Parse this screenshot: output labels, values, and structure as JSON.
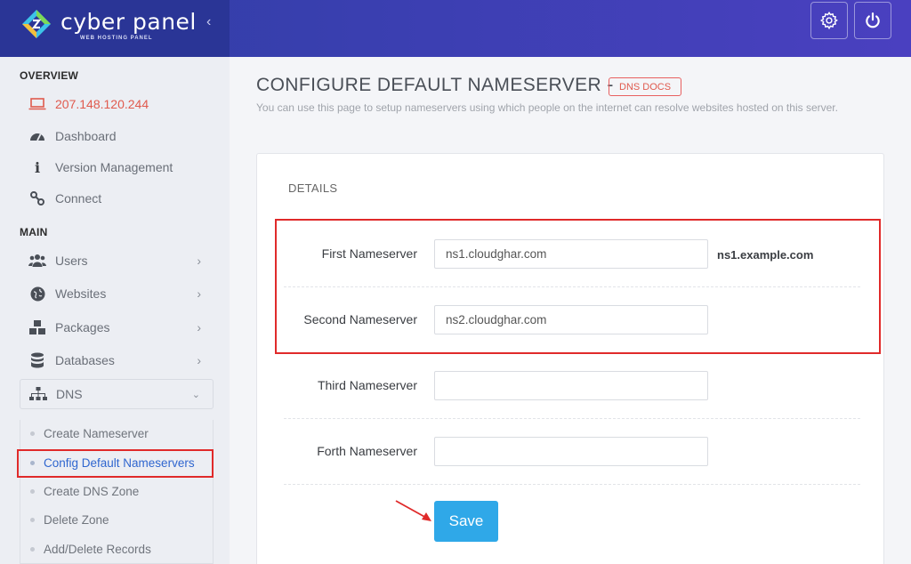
{
  "brand": {
    "name": "cyber panel",
    "tagline": "WEB HOSTING PANEL"
  },
  "topbar": {
    "settings_icon": "gear-icon",
    "power_icon": "power-icon"
  },
  "sidebar": {
    "overview_heading": "OVERVIEW",
    "ip": "207.148.120.244",
    "dashboard": "Dashboard",
    "version": "Version Management",
    "connect": "Connect",
    "main_heading": "MAIN",
    "users": "Users",
    "websites": "Websites",
    "packages": "Packages",
    "databases": "Databases",
    "dns": "DNS",
    "dns_items": [
      "Create Nameserver",
      "Config Default Nameservers",
      "Create DNS Zone",
      "Delete Zone",
      "Add/Delete Records"
    ]
  },
  "page": {
    "title": "CONFIGURE DEFAULT NAMESERVER -",
    "docs_badge": "DNS DOCS",
    "subtitle": "You can use this page to setup nameservers using which people on the internet can resolve websites hosted on this server.",
    "details": "DETAILS"
  },
  "form": {
    "first_label": "First Nameserver",
    "first_value": "ns1.cloudghar.com",
    "first_hint": "ns1.example.com",
    "second_label": "Second Nameserver",
    "second_value": "ns2.cloudghar.com",
    "third_label": "Third Nameserver",
    "third_value": "",
    "forth_label": "Forth Nameserver",
    "forth_value": "",
    "save_label": "Save"
  },
  "colors": {
    "accent": "#2fa8e8",
    "highlight": "#e02a2a",
    "topbar": "#3a3fb0",
    "link_active": "#2f66cf",
    "ip": "#e05a4e"
  }
}
